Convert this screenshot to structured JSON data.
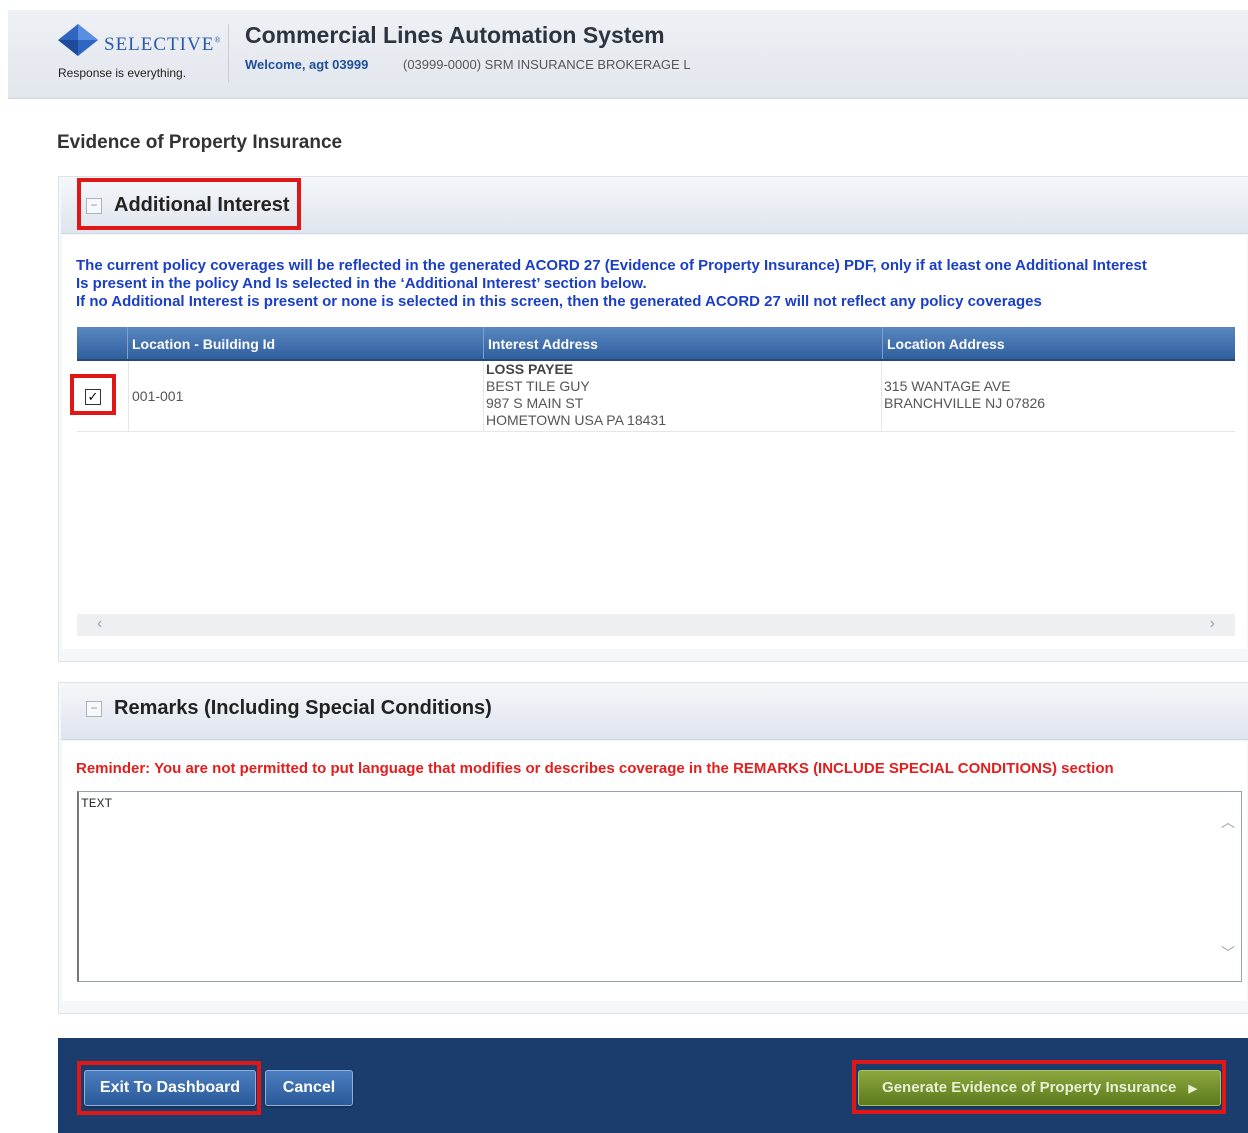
{
  "header": {
    "brand": "SELECTIVE",
    "tagline": "Response is everything.",
    "app_title": "Commercial Lines Automation System",
    "welcome": "Welcome, agt 03999",
    "agency": "(03999-0000) SRM INSURANCE BROKERAGE L"
  },
  "page_title": "Evidence of Property Insurance",
  "additional_interest": {
    "title": "Additional Interest",
    "info_lines": [
      "The current policy coverages will be reflected in the generated ACORD 27 (Evidence of Property Insurance) PDF, only if at least one Additional Interest",
      "Is present in the policy And Is selected in the ‘Additional Interest’ section below.",
      "If no Additional Interest is present or none is selected in this screen, then the generated ACORD 27 will not reflect any policy coverages"
    ],
    "columns": [
      "Location - Building Id",
      "Interest Address",
      "Location Address"
    ],
    "rows": [
      {
        "checked": true,
        "location_building_id": "001-001",
        "interest_type": "LOSS PAYEE",
        "interest_address": [
          "BEST TILE GUY",
          "987 S MAIN ST",
          "HOMETOWN USA PA 18431"
        ],
        "location_address": [
          "315 WANTAGE AVE",
          "BRANCHVILLE NJ 07826"
        ]
      }
    ]
  },
  "remarks": {
    "title": "Remarks (Including Special Conditions)",
    "reminder": "Reminder: You are not permitted to put language that modifies or describes coverage in the REMARKS (INCLUDE SPECIAL CONDITIONS) section",
    "text": "TEXT"
  },
  "footer": {
    "exit_label": "Exit To Dashboard",
    "cancel_label": "Cancel",
    "generate_label": "Generate Evidence of Property Insurance"
  },
  "colors": {
    "highlight": "#e01717",
    "footer_bg": "#1a3d6e",
    "info_text": "#1a3fc4",
    "reminder_text": "#e41d1d"
  }
}
